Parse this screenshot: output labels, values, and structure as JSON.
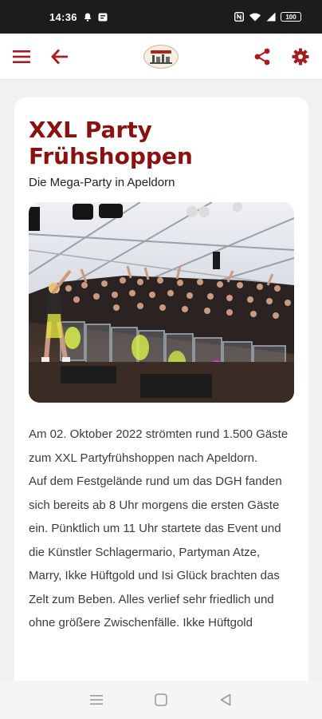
{
  "status_bar": {
    "time": "14:36",
    "battery": "100"
  },
  "app_bar": {
    "menu_icon": "menu-icon",
    "back_icon": "arrow-left-icon",
    "logo_name": "festival-logo",
    "share_icon": "share-icon",
    "settings_icon": "gear-icon",
    "accent_color": "#a81c1c"
  },
  "article": {
    "title": "XXL Party Frühshoppen",
    "subtitle": "Die Mega-Party in Apeldorn",
    "paragraph1": "Am 02. Oktober 2022 strömten rund 1.500 Gäste zum XXL Partyfrühshoppen nach Apeldorn.",
    "paragraph2": "Auf dem Festgelände rund um das DGH fanden sich bereits ab 8 Uhr morgens die ersten Gäste ein. Pünktlich um 11 Uhr startete das Event und die Künstler Schlagermario, Partyman Atze, Marry, Ikke Hüftgold und Isi Glück brachten das Zelt zum Beben. Alles verlief sehr friedlich und ohne größere Zwischenfälle. Ikke Hüftgold"
  },
  "nav_bar": {
    "recents_icon": "recents-icon",
    "home_icon": "home-icon",
    "back_icon": "triangle-back-icon"
  }
}
